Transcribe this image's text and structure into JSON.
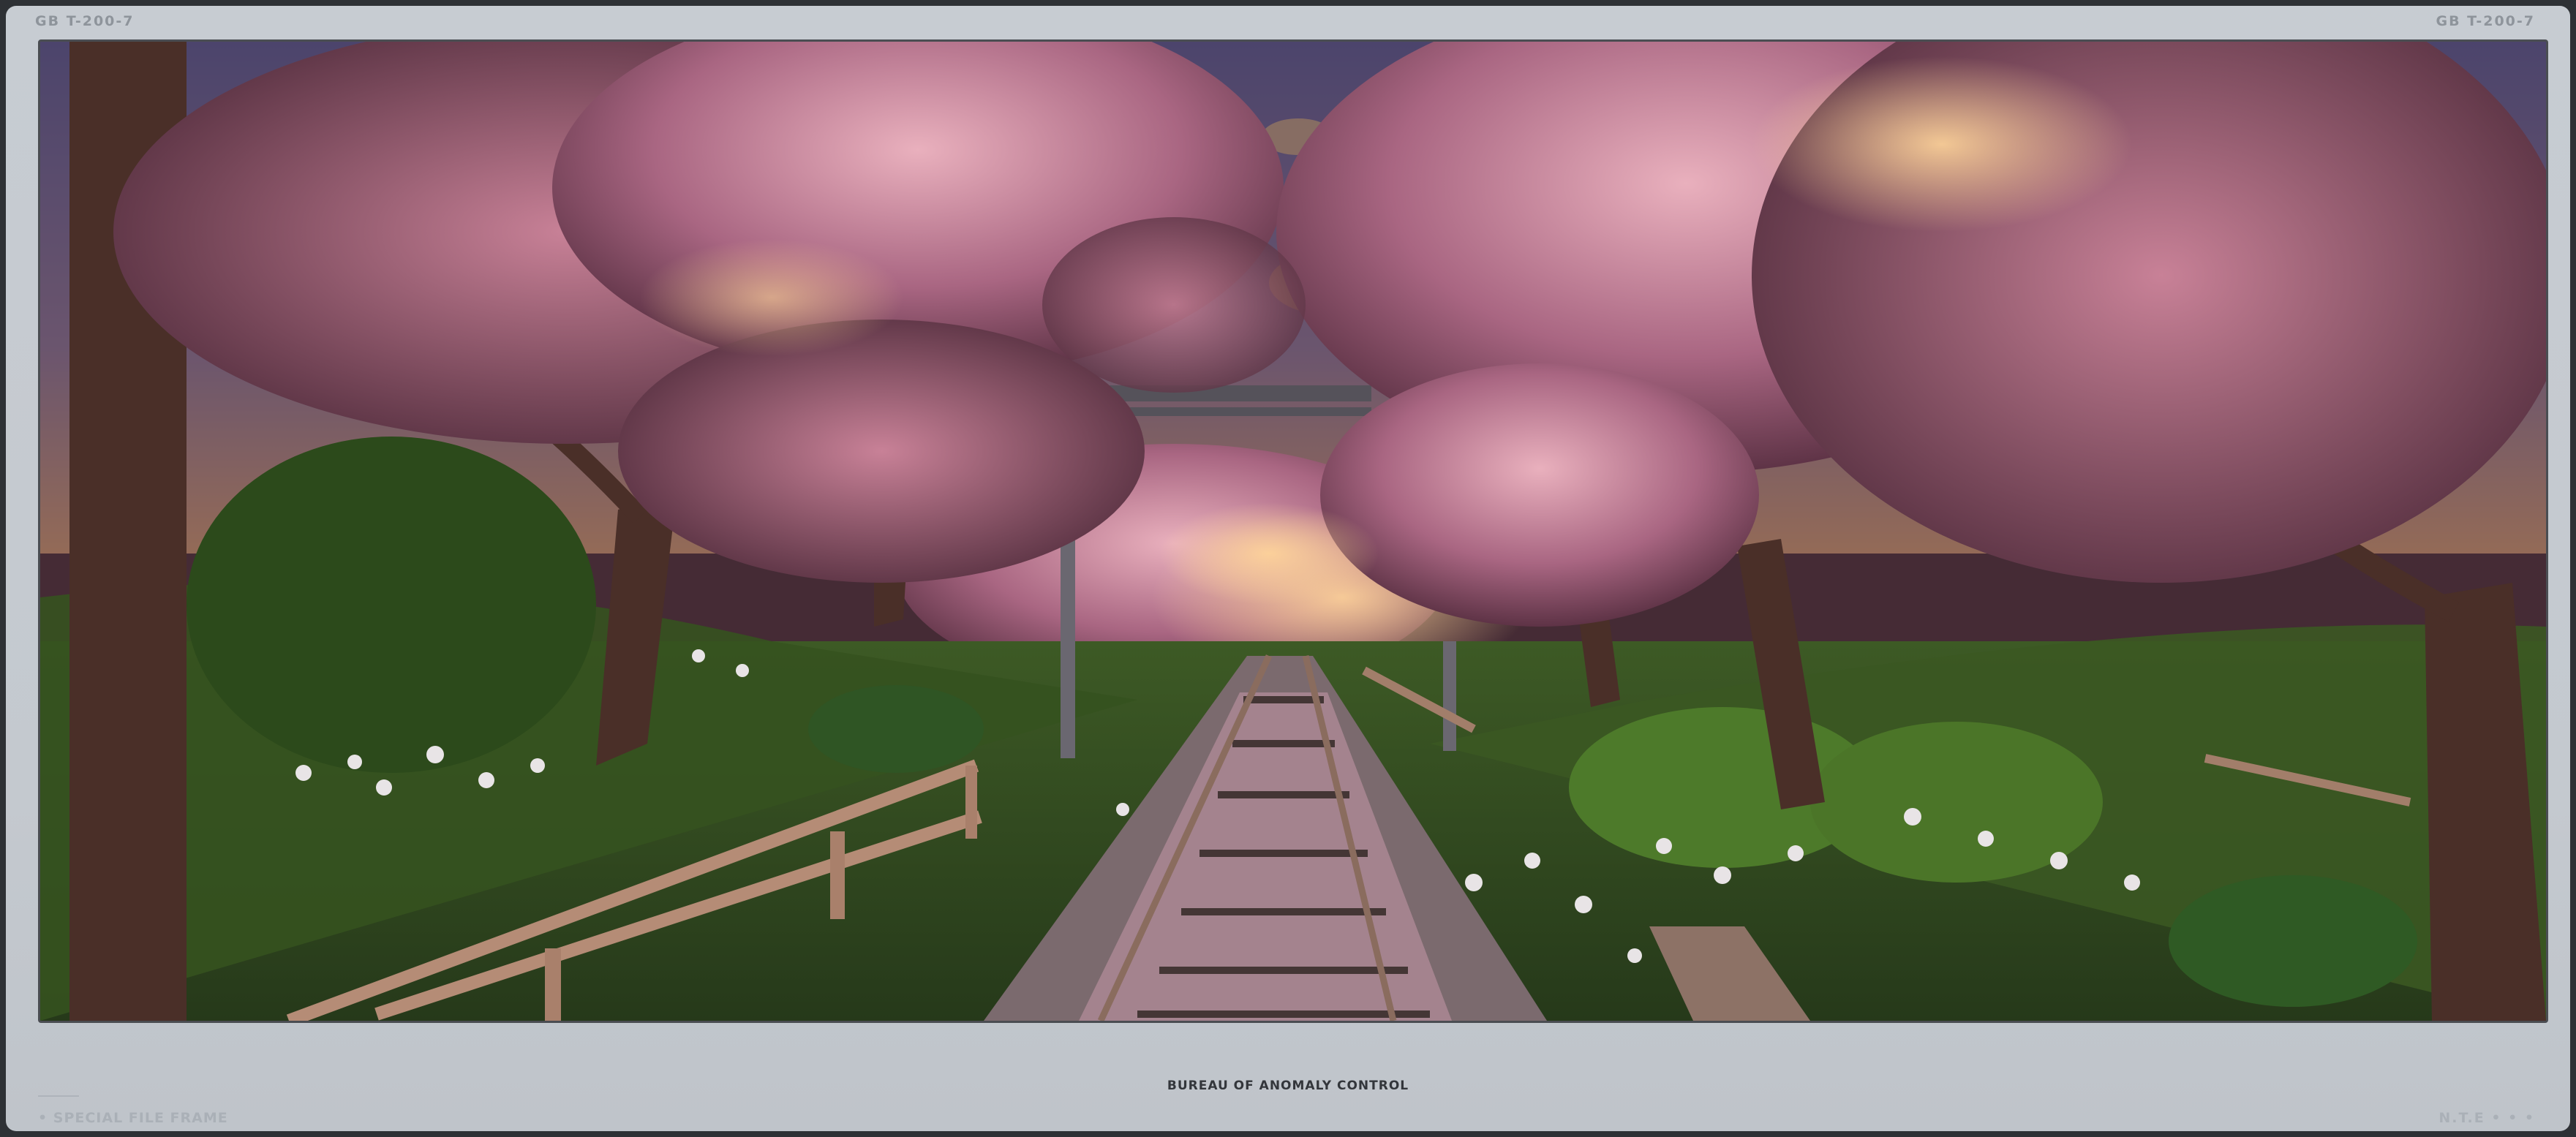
{
  "frame": {
    "top_left_code": "GB   T-200-7",
    "top_right_code": "GB   T-200-7",
    "caption": "BUREAU OF ANOMALY CONTROL",
    "footer_left": "• SPECIAL FILE FRAME",
    "footer_right": "N.T.E • • •"
  },
  "photo": {
    "subject": "railway-track-through-cherry-blossom-trees",
    "colors": {
      "sky": "#5a6fae",
      "blossom": "#b3738e",
      "blossom_light": "#e0a9b8",
      "grass": "#3f5a26",
      "trunk": "#4a2f28",
      "rail": "#6b5a55"
    }
  }
}
